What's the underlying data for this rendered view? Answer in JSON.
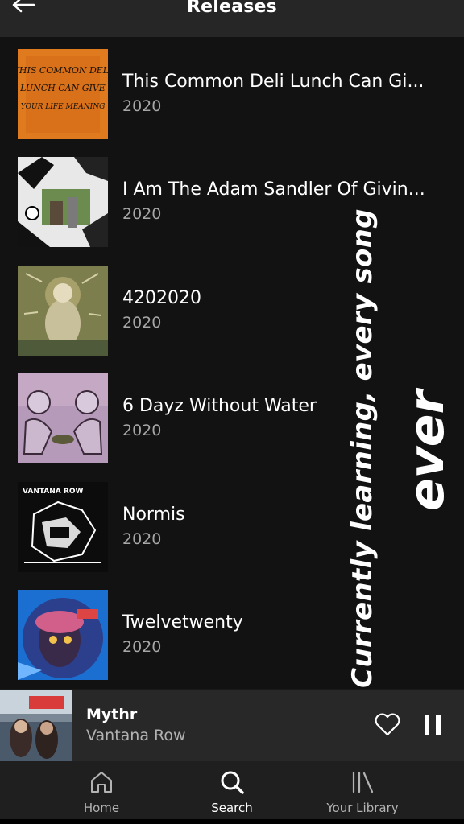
{
  "header": {
    "title": "Releases",
    "back_icon": "arrow-left-icon"
  },
  "releases": [
    {
      "title": "This Common Deli Lunch Can Gi...",
      "year": "2020",
      "cover_text": [
        "THIS COMMON DELI",
        "LUNCH CAN GIVE",
        "YOUR LIFE MEANING"
      ],
      "cover_color": "#e07a1e"
    },
    {
      "title": "I Am The Adam Sandler Of Givin...",
      "year": "2020",
      "cover_color": "#e8e8e8"
    },
    {
      "title": "4202020",
      "year": "2020",
      "cover_color": "#8a8a55"
    },
    {
      "title": "6 Dayz Without Water",
      "year": "2020",
      "cover_color": "#b69ab9"
    },
    {
      "title": "Normis",
      "year": "2020",
      "cover_text": [
        "VANTANA ROW"
      ],
      "cover_color": "#0c0c0c"
    },
    {
      "title": "Twelvetwenty",
      "year": "2020",
      "cover_color": "#2b5cc4"
    }
  ],
  "caption": {
    "line1": "Currently learning, every song",
    "line2": "ever"
  },
  "now_playing": {
    "title": "Mythr",
    "artist": "Vantana Row",
    "heart_icon": "heart-outline-icon",
    "pause_icon": "pause-icon"
  },
  "nav": [
    {
      "label": "Home",
      "icon": "home-icon",
      "active": false
    },
    {
      "label": "Search",
      "icon": "search-icon",
      "active": true
    },
    {
      "label": "Your Library",
      "icon": "library-icon",
      "active": false
    }
  ]
}
